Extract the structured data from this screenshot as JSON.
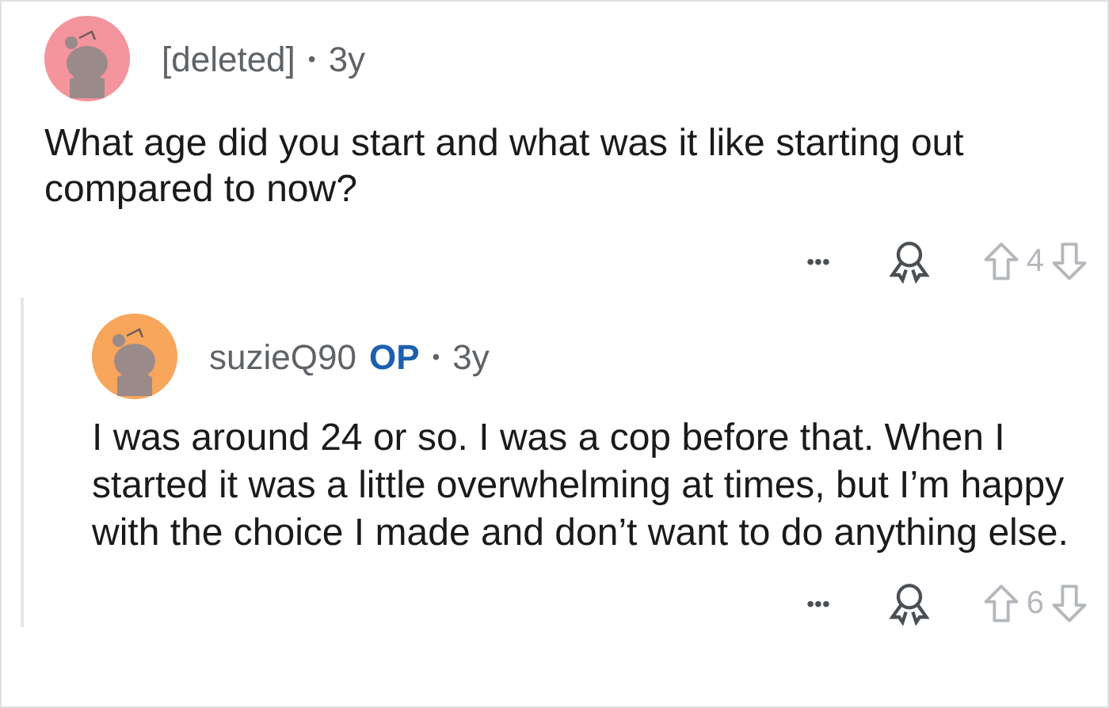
{
  "comments": [
    {
      "author": "[deleted]",
      "color": "#f4949c",
      "separator": "•",
      "time": "3y",
      "body": "What age did you start and what was it like starting out compared to now?",
      "more": "•••",
      "votes": "4",
      "children": [
        {
          "author": "suzieQ90",
          "op_label": "OP",
          "color": "#f7a65c",
          "separator": "•",
          "time": "3y",
          "body": "I was around 24 or so. I was a cop before that. When I started it was a little overwhelming at times, but I’m happy with the choice I made and don’t want to do anything else.",
          "more": "•••",
          "votes": "6"
        }
      ]
    }
  ]
}
